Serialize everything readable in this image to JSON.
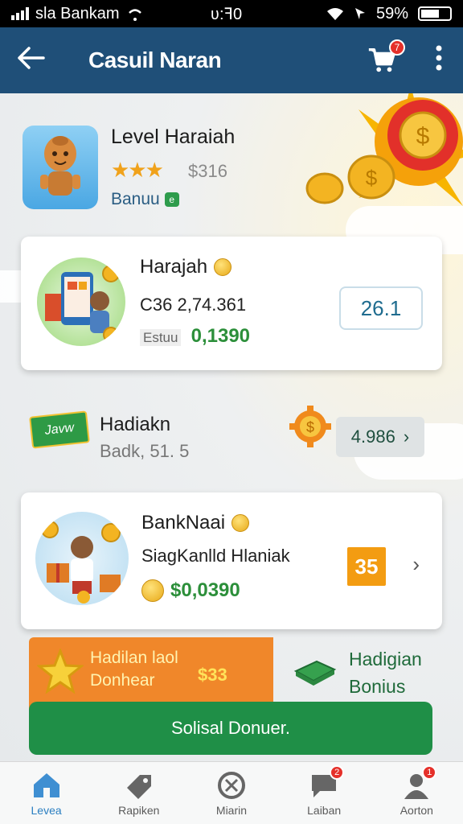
{
  "status_bar": {
    "carrier": "sla Bankam",
    "time": "ʋ:ꟻ0",
    "battery": "59%"
  },
  "header": {
    "title": "Casuil Naran",
    "cart_badge": "7"
  },
  "level": {
    "title": "Level Haraiah",
    "stars": "★★★",
    "score": "$316",
    "subtitle": "Banuu",
    "subtitle_icon": "e"
  },
  "card1": {
    "title": "Harajah",
    "line1": "C36 2,74.361",
    "label": "Estuu",
    "green_value": "0,1390",
    "box_value": "26.1"
  },
  "row2": {
    "tag": "Javw",
    "title": "Hadiakn",
    "subtitle": "Badk, 51. 5",
    "pill_value": "4.986"
  },
  "card2": {
    "title": "BankNaai",
    "line1": "SiagKanlld Hlaniak",
    "green_value": "$0,0390",
    "box_value": "35"
  },
  "promo": {
    "left_line1": "Hadilan laol",
    "left_line2": "Donhear",
    "price": "$33",
    "right_line1": "Hadigian",
    "right_line2": "Bonius"
  },
  "cta": {
    "label": "Solisal Donuer."
  },
  "bottom_nav": {
    "items": [
      {
        "label": "Levea",
        "icon": "home-icon"
      },
      {
        "label": "Rapiken",
        "icon": "tag-icon"
      },
      {
        "label": "Miarin",
        "icon": "support-icon"
      },
      {
        "label": "Laiban",
        "icon": "chat-icon",
        "badge": "2"
      },
      {
        "label": "Aorton",
        "icon": "profile-icon",
        "badge": "1"
      }
    ]
  },
  "colors": {
    "header_bg": "#1f4f78",
    "cta_bg": "#1f8f47",
    "promo_orange": "#f0872a",
    "accent_green": "#2c8f3a",
    "active_nav": "#2a7ec1"
  }
}
